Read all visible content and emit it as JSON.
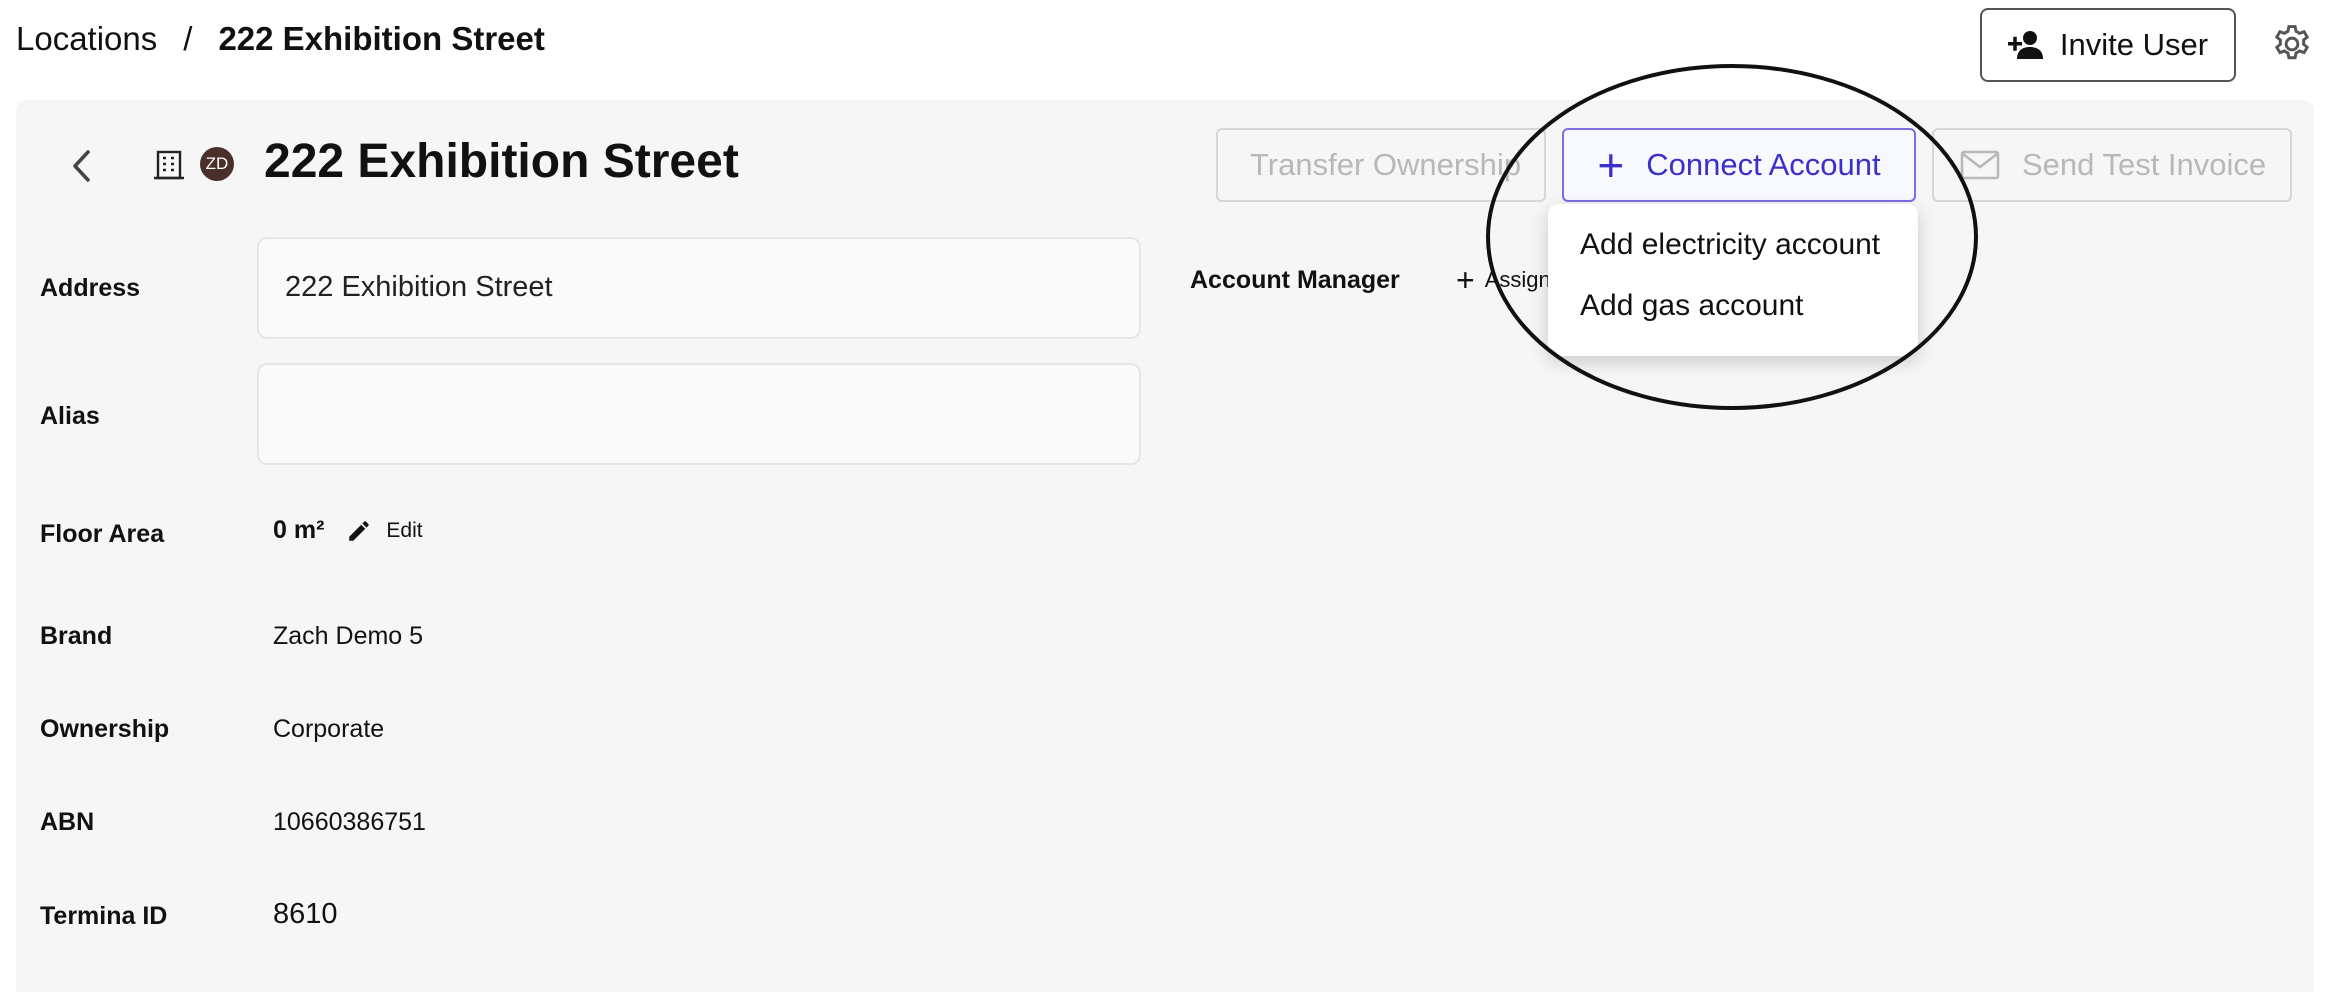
{
  "breadcrumb": {
    "root": "Locations",
    "separator": "/",
    "current": "222 Exhibition Street"
  },
  "header": {
    "invite_label": "Invite User"
  },
  "location": {
    "title": "222 Exhibition Street",
    "avatar_initials": "ZD",
    "buttons": {
      "transfer": "Transfer Ownership",
      "connect": "Connect Account",
      "send_invoice": "Send Test Invoice"
    }
  },
  "menu": {
    "items": [
      "Add electricity account",
      "Add gas account"
    ]
  },
  "details": {
    "address_label": "Address",
    "address_value": "222 Exhibition Street",
    "alias_label": "Alias",
    "alias_value": "",
    "floor_area_label": "Floor Area",
    "floor_area_value": "0 m²",
    "floor_area_edit": "Edit",
    "brand_label": "Brand",
    "brand_value": "Zach Demo 5",
    "ownership_label": "Ownership",
    "ownership_value": "Corporate",
    "abn_label": "ABN",
    "abn_value": "10660386751",
    "termina_label": "Termina ID",
    "termina_value": "8610"
  },
  "account_manager": {
    "label": "Account Manager",
    "assign_label": "Assign"
  },
  "colors": {
    "accent": "#3b30cc",
    "panel_bg": "#f6f6f6",
    "disabled_text": "#b8b8b8"
  },
  "icons": [
    "add-user-icon",
    "gear-icon",
    "chevron-left-icon",
    "building-icon",
    "plus-icon",
    "mail-icon",
    "pencil-icon"
  ]
}
